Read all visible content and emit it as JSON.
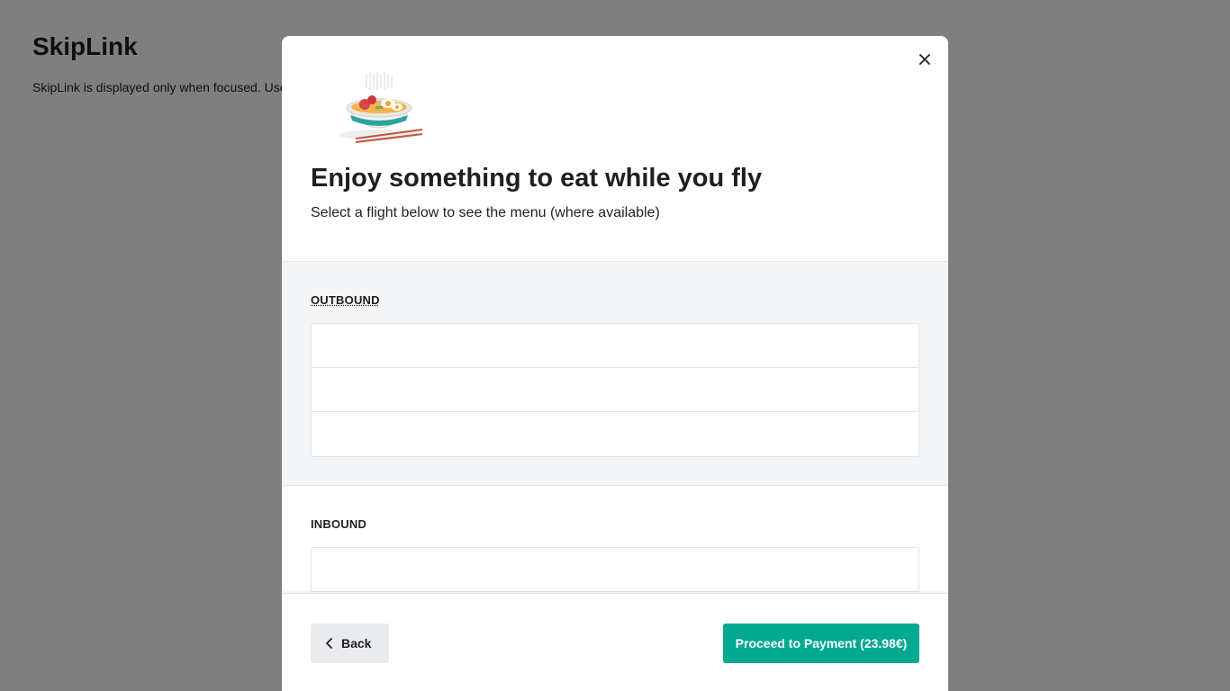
{
  "page": {
    "title": "SkipLink",
    "description": "SkipLink is displayed only when focused. Use"
  },
  "modal": {
    "title": "Enjoy something to eat while you fly",
    "subtitle": "Select a flight below to see the menu (where available)",
    "close_icon": "close-icon",
    "illustration": "noodle-bowl-illustration"
  },
  "sections": {
    "outbound": {
      "label": "OUTBOUND",
      "rows": [
        "",
        "",
        ""
      ]
    },
    "inbound": {
      "label": "INBOUND",
      "rows": [
        "",
        ""
      ]
    }
  },
  "footer": {
    "back_label": "Back",
    "back_icon": "chevron-left-icon",
    "pay_label": "Proceed to Payment (23.98€)"
  },
  "colors": {
    "primary": "#00a991",
    "overlay": "rgba(0,0,0,0.5)",
    "section_bg": "#f4f5f7"
  }
}
